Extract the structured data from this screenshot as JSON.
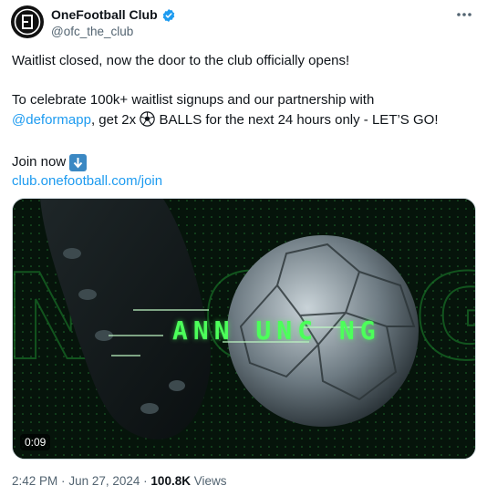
{
  "account": {
    "name": "OneFootball Club",
    "handle": "@ofc_the_club",
    "verified": true,
    "avatar_monogram": "OFC"
  },
  "tweet": {
    "line1": "Waitlist closed, now the door to the club officially opens!",
    "line2_before": "To celebrate 100k+ waitlist signups and our partnership with",
    "mention": "@deformapp",
    "line3_after_mention": ", get 2x",
    "ball_emoji": "⚽",
    "line3_end": "BALLS for the next 24 hours only - LET’S GO!",
    "join_text": "Join now",
    "down_arrow_emoji": "⬇",
    "link": "club.onefootball.com/join"
  },
  "media": {
    "overlay_text": "ANN  UNC NG",
    "duration": "0:09"
  },
  "footer": {
    "time": "2:42 PM",
    "separator": "·",
    "date": "Jun 27, 2024",
    "views_count": "100.8K",
    "views_label": "Views"
  },
  "colors": {
    "link": "#1d9bf0",
    "verified": "#1d9bf0",
    "secondary_text": "#536471",
    "video_accent": "#4cff5a"
  },
  "icons": {
    "verified": "verified-badge-icon",
    "more": "more-horizontal-icon",
    "ball": "soccer-ball-icon",
    "arrow": "down-arrow-icon"
  }
}
